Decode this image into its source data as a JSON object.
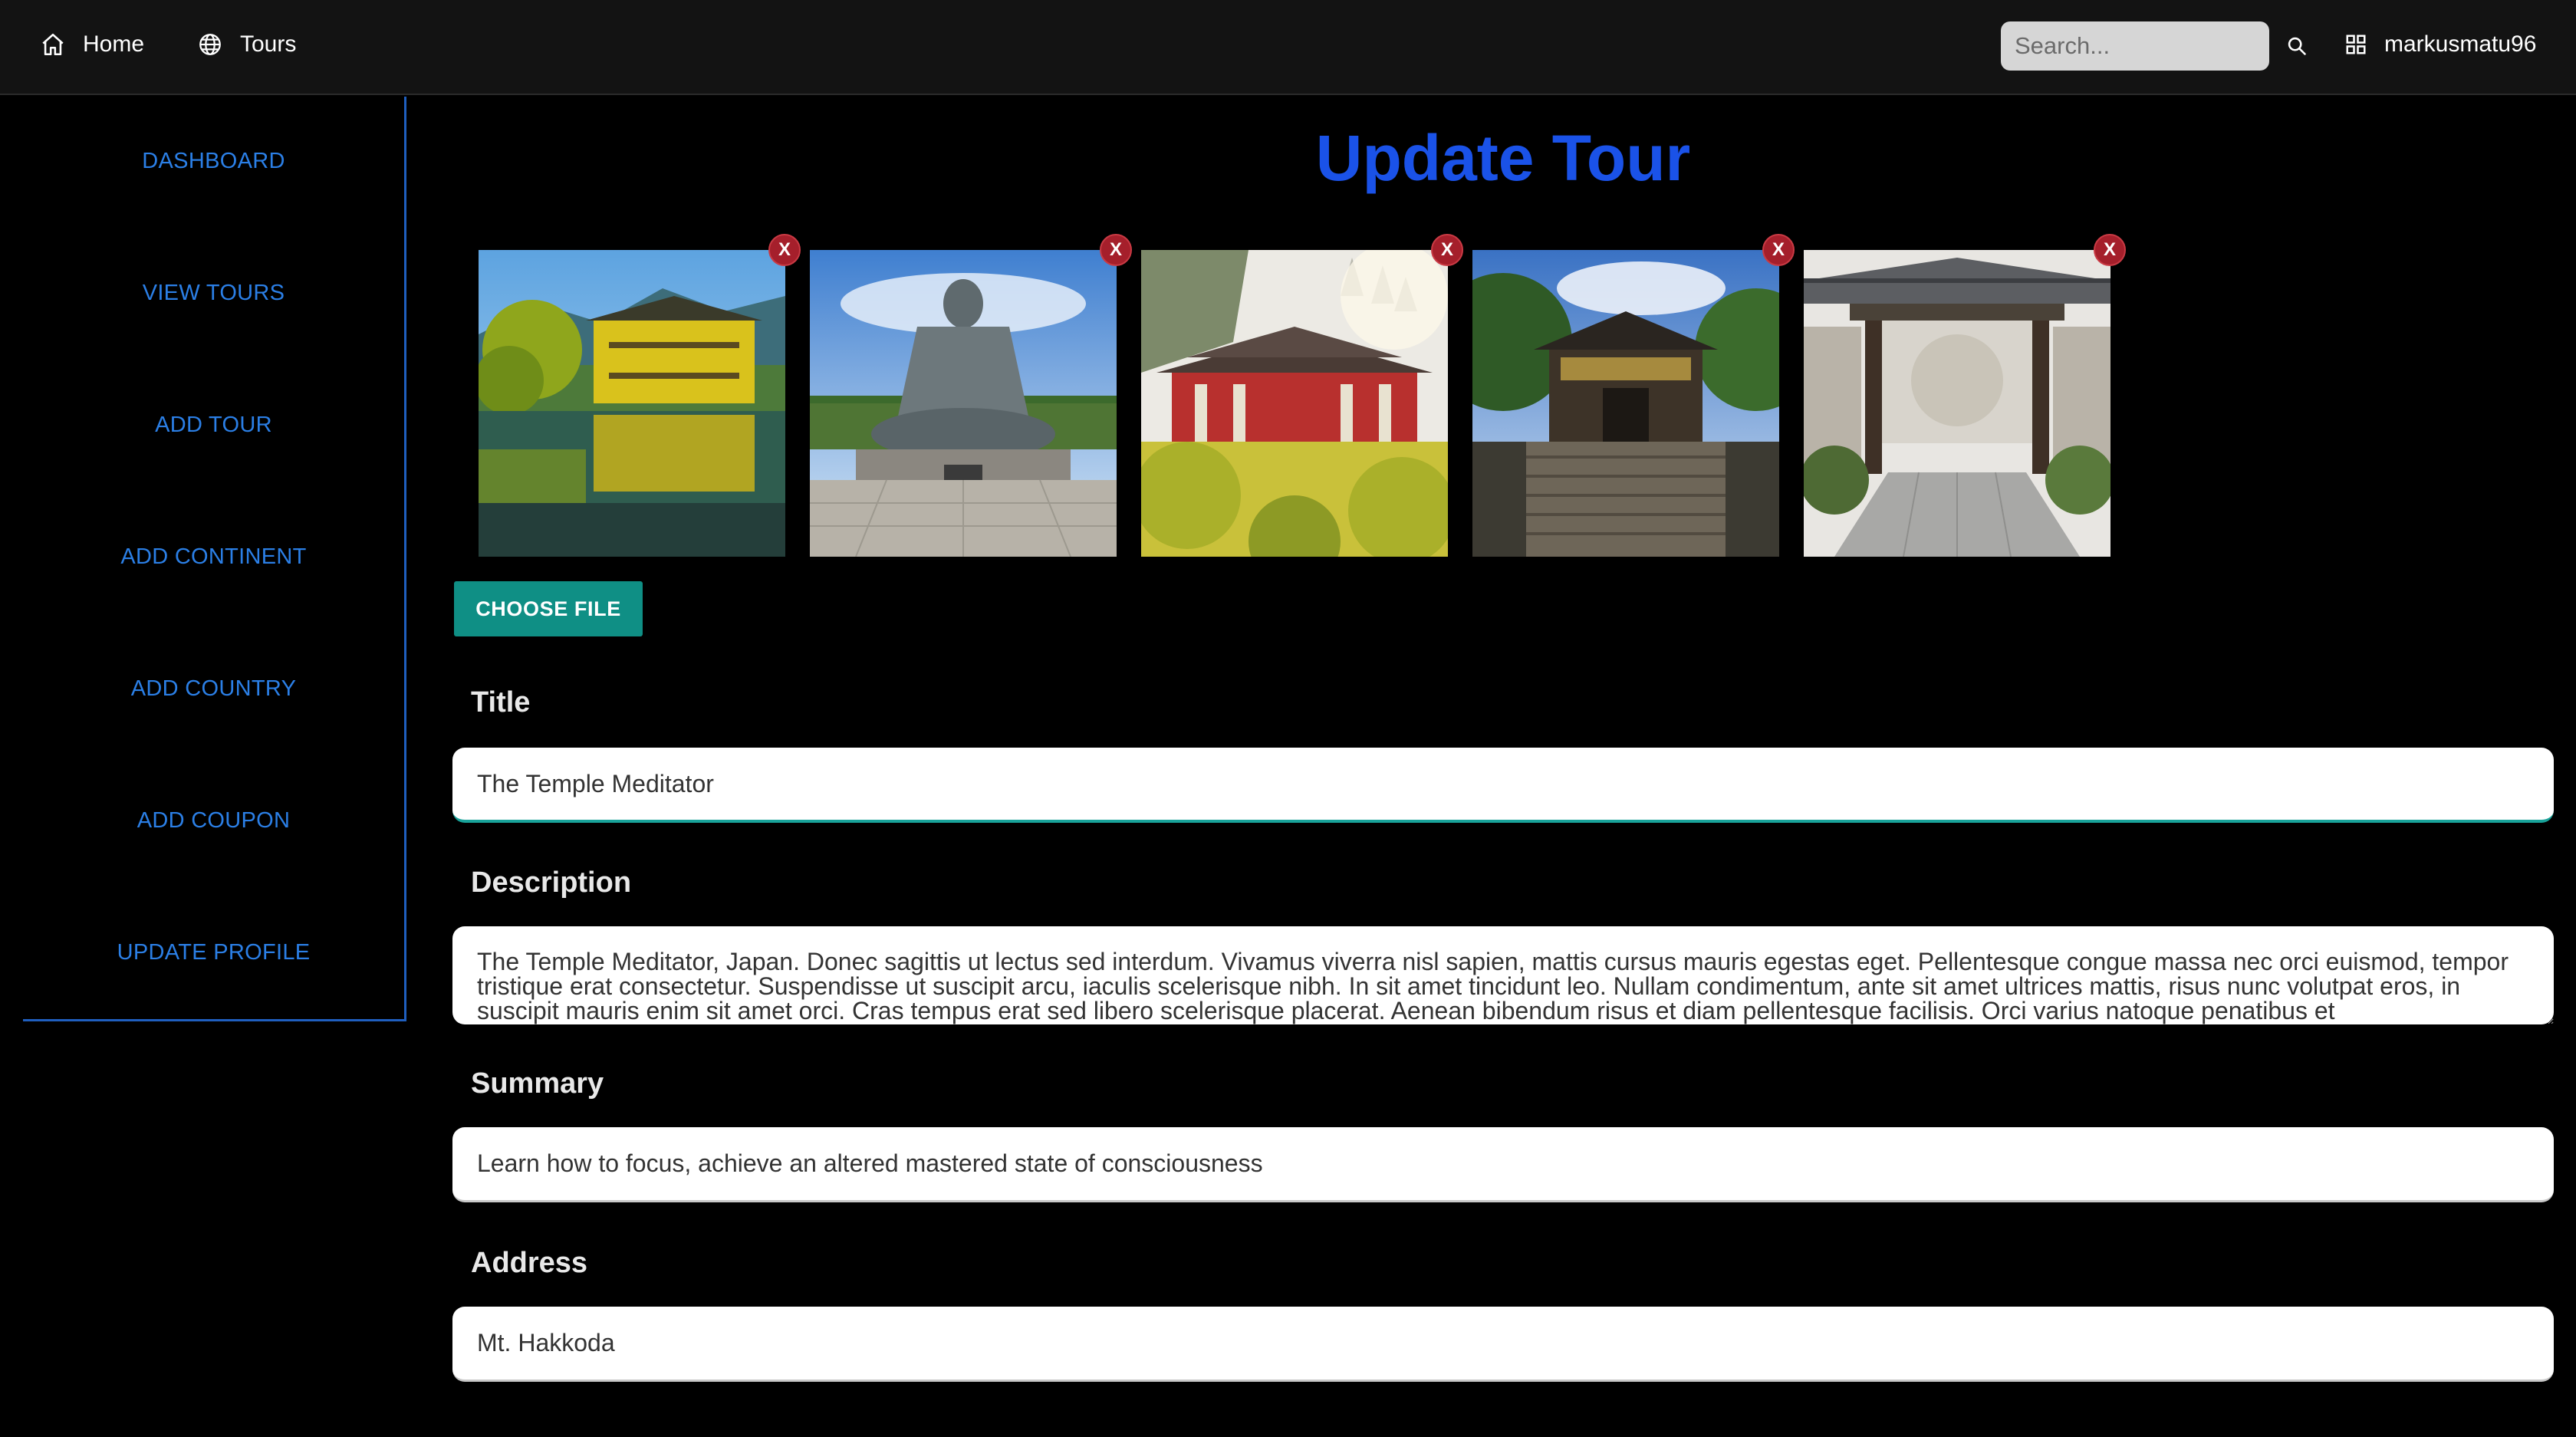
{
  "navbar": {
    "home_label": "Home",
    "tours_label": "Tours",
    "search_placeholder": "Search...",
    "username": "markusmatu96"
  },
  "sidebar": {
    "items": [
      {
        "label": "DASHBOARD"
      },
      {
        "label": "VIEW TOURS"
      },
      {
        "label": "ADD TOUR"
      },
      {
        "label": "ADD CONTINENT"
      },
      {
        "label": "ADD COUNTRY"
      },
      {
        "label": "ADD COUPON"
      },
      {
        "label": "UPDATE PROFILE"
      }
    ]
  },
  "main": {
    "page_title": "Update Tour",
    "images": [
      {
        "subject": "golden-pavilion-temple",
        "remove_label": "X"
      },
      {
        "subject": "great-buddha-statue",
        "remove_label": "X"
      },
      {
        "subject": "red-temple-hall",
        "remove_label": "X"
      },
      {
        "subject": "shrine-gate-stairs",
        "remove_label": "X"
      },
      {
        "subject": "temple-gate-garden",
        "remove_label": "X"
      }
    ],
    "choose_file_label": "CHOOSE FILE",
    "form": {
      "title_label": "Title",
      "title_value": "The Temple Meditator",
      "description_label": "Description",
      "description_value": "The Temple Meditator, Japan. Donec sagittis ut lectus sed interdum. Vivamus viverra nisl sapien, mattis cursus mauris egestas eget. Pellentesque congue massa nec orci euismod, tempor tristique erat consectetur. Suspendisse ut suscipit arcu, iaculis scelerisque nibh. In sit amet tincidunt leo. Nullam condimentum, ante sit amet ultrices mattis, risus nunc volutpat eros, in suscipit mauris enim sit amet orci. Cras tempus erat sed libero scelerisque placerat. Aenean bibendum risus et diam pellentesque facilisis. Orci varius natoque penatibus et",
      "summary_label": "Summary",
      "summary_value": "Learn how to focus, achieve an altered mastered state of consciousness",
      "address_label": "Address",
      "address_value": "Mt. Hakkoda"
    }
  },
  "colors": {
    "accent_blue": "#1a52e8",
    "sidebar_link": "#2b7fe6",
    "button_teal": "#0f8f85",
    "remove_red": "#a51f2b"
  }
}
